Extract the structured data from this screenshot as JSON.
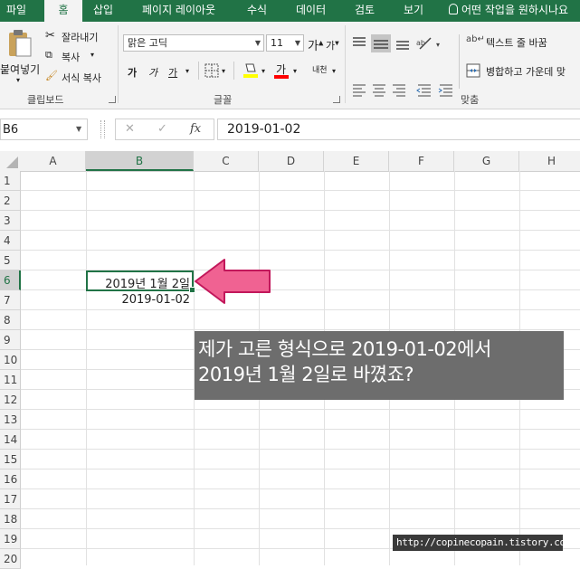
{
  "tabs": [
    "파일",
    "홈",
    "삽입",
    "페이지 레이아웃",
    "수식",
    "데이터",
    "검토",
    "보기"
  ],
  "tell_me": "어떤 작업을 원하시나요",
  "clipboard": {
    "paste": "붙여넣기",
    "cut": "잘라내기",
    "copy": "복사",
    "format_painter": "서식 복사",
    "group": "클립보드"
  },
  "font": {
    "name": "맑은 고딕",
    "size": "11",
    "group": "글꼴",
    "grow": "가",
    "shrink": "가",
    "bold": "가",
    "italic": "가",
    "underline": "가",
    "font_color": "가",
    "phonetic": "내천"
  },
  "alignment": {
    "wrap": "텍스트 줄 바꿈",
    "merge": "병합하고 가운데 맞",
    "group": "맞춤"
  },
  "formula_bar": {
    "name_box": "B6",
    "cancel": "✕",
    "enter": "✓",
    "fx": "fx",
    "content": "2019-01-02"
  },
  "columns": [
    "A",
    "B",
    "C",
    "D",
    "E",
    "F",
    "G",
    "H"
  ],
  "rows": [
    "1",
    "2",
    "3",
    "4",
    "5",
    "6",
    "7",
    "8",
    "9",
    "10",
    "11",
    "12",
    "13",
    "14",
    "15",
    "16",
    "17",
    "18",
    "19",
    "20"
  ],
  "cells": {
    "b6": "2019년 1월 2일",
    "b7": "2019-01-02"
  },
  "annotation": {
    "line1": "제가 고른 형식으로 2019-01-02에서",
    "line2": "2019년 1월 2일로 바꼈죠?"
  },
  "watermark": "http://copinecopain.tistory.com",
  "colors": {
    "excel_green": "#217346",
    "arrow_pink": "#f06292",
    "selection": "#217346"
  }
}
